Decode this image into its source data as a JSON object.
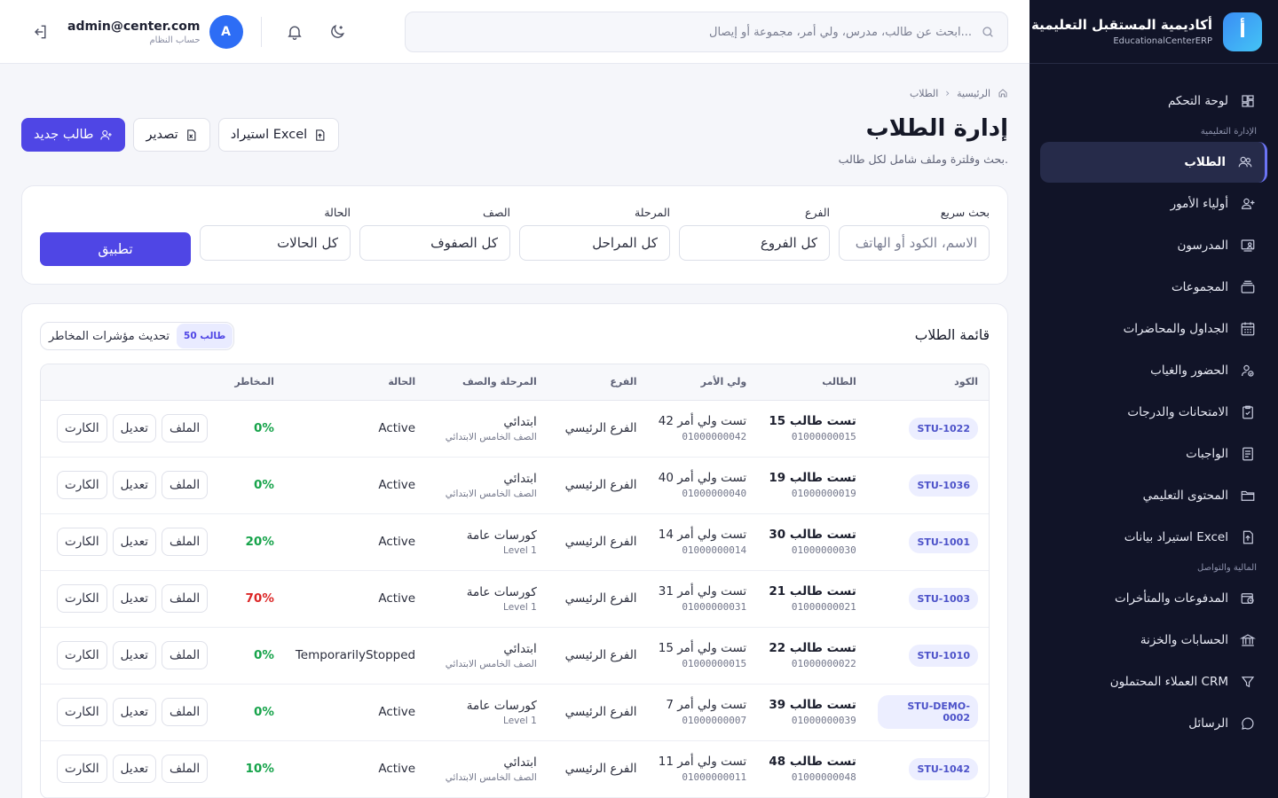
{
  "brand": {
    "title": "أكاديمية المستقبل التعليمية",
    "subtitle": "EducationalCenterERP",
    "logo_letter": "أ"
  },
  "sidebar": {
    "items_top": [
      {
        "label": "لوحة التحكم",
        "icon": "dashboard-icon"
      }
    ],
    "section_1": "الإدارة التعليمية",
    "items_1": [
      {
        "label": "الطلاب",
        "icon": "students-icon",
        "active": true
      },
      {
        "label": "أولياء الأمور",
        "icon": "parents-icon"
      },
      {
        "label": "المدرسون",
        "icon": "teachers-icon"
      },
      {
        "label": "المجموعات",
        "icon": "groups-icon"
      },
      {
        "label": "الجداول والمحاضرات",
        "icon": "calendar-icon"
      },
      {
        "label": "الحضور والغياب",
        "icon": "attendance-icon"
      },
      {
        "label": "الامتحانات والدرجات",
        "icon": "exams-icon"
      },
      {
        "label": "الواجبات",
        "icon": "assignments-icon"
      },
      {
        "label": "المحتوى التعليمي",
        "icon": "folder-icon"
      },
      {
        "label": "استيراد بيانات Excel",
        "icon": "import-icon"
      }
    ],
    "section_2": "المالية والتواصل",
    "items_2": [
      {
        "label": "المدفوعات والمتأخرات",
        "icon": "payments-icon"
      },
      {
        "label": "الحسابات والخزنة",
        "icon": "bank-icon"
      },
      {
        "label": "العملاء المحتملون CRM",
        "icon": "funnel-icon"
      },
      {
        "label": "الرسائل",
        "icon": "messages-icon"
      }
    ]
  },
  "topbar": {
    "search_placeholder": "ابحث عن طالب، مدرس، ولي أمر، مجموعة أو إيصال...",
    "user_email": "admin@center.com",
    "user_role": "حساب النظام",
    "avatar_letter": "A"
  },
  "breadcrumb": {
    "home": "الرئيسية",
    "current": "الطلاب"
  },
  "page": {
    "title": "إدارة الطلاب",
    "subtitle": "بحث وفلترة وملف شامل لكل طالب.",
    "import_label": "استيراد Excel",
    "export_label": "تصدير",
    "new_label": "طالب جديد"
  },
  "filters": {
    "search": {
      "label": "بحث سريع",
      "placeholder": "الاسم، الكود أو الهاتف"
    },
    "branch": {
      "label": "الفرع",
      "value": "كل الفروع"
    },
    "stage": {
      "label": "المرحلة",
      "value": "كل المراحل"
    },
    "grade": {
      "label": "الصف",
      "value": "كل الصفوف"
    },
    "status": {
      "label": "الحالة",
      "value": "كل الحالات"
    },
    "apply_label": "تطبيق"
  },
  "list": {
    "title": "قائمة الطلاب",
    "count_badge": "50 طالب",
    "refresh_risk_label": "تحديث مؤشرات المخاطر",
    "columns": [
      "الكود",
      "الطالب",
      "ولي الأمر",
      "الفرع",
      "المرحلة والصف",
      "الحالة",
      "المخاطر",
      ""
    ],
    "action_labels": {
      "profile": "الملف",
      "edit": "تعديل",
      "card": "الكارت"
    },
    "rows": [
      {
        "code": "STU-1022",
        "name": "تست طالب 15",
        "phone": "01000000015",
        "parent": "تست ولي أمر 42",
        "parent_phone": "01000000042",
        "branch": "الفرع الرئيسي",
        "stage": "ابتدائي",
        "grade": "الصف الخامس الابتدائي",
        "status": "Active",
        "risk": "0%",
        "risk_color": "#16a34a"
      },
      {
        "code": "STU-1036",
        "name": "تست طالب 19",
        "phone": "01000000019",
        "parent": "تست ولي أمر 40",
        "parent_phone": "01000000040",
        "branch": "الفرع الرئيسي",
        "stage": "ابتدائي",
        "grade": "الصف الخامس الابتدائي",
        "status": "Active",
        "risk": "0%",
        "risk_color": "#16a34a"
      },
      {
        "code": "STU-1001",
        "name": "تست طالب 30",
        "phone": "01000000030",
        "parent": "تست ولي أمر 14",
        "parent_phone": "01000000014",
        "branch": "الفرع الرئيسي",
        "stage": "كورسات عامة",
        "grade": "Level 1",
        "status": "Active",
        "risk": "20%",
        "risk_color": "#16a34a"
      },
      {
        "code": "STU-1003",
        "name": "تست طالب 21",
        "phone": "01000000021",
        "parent": "تست ولي أمر 31",
        "parent_phone": "01000000031",
        "branch": "الفرع الرئيسي",
        "stage": "كورسات عامة",
        "grade": "Level 1",
        "status": "Active",
        "risk": "70%",
        "risk_color": "#dc2626"
      },
      {
        "code": "STU-1010",
        "name": "تست طالب 22",
        "phone": "01000000022",
        "parent": "تست ولي أمر 15",
        "parent_phone": "01000000015",
        "branch": "الفرع الرئيسي",
        "stage": "ابتدائي",
        "grade": "الصف الخامس الابتدائي",
        "status": "TemporarilyStopped",
        "risk": "0%",
        "risk_color": "#16a34a"
      },
      {
        "code": "STU-DEMO-0002",
        "name": "تست طالب 39",
        "phone": "01000000039",
        "parent": "تست ولي أمر 7",
        "parent_phone": "01000000007",
        "branch": "الفرع الرئيسي",
        "stage": "كورسات عامة",
        "grade": "Level 1",
        "status": "Active",
        "risk": "0%",
        "risk_color": "#16a34a"
      },
      {
        "code": "STU-1042",
        "name": "تست طالب 48",
        "phone": "01000000048",
        "parent": "تست ولي أمر 11",
        "parent_phone": "01000000011",
        "branch": "الفرع الرئيسي",
        "stage": "ابتدائي",
        "grade": "الصف الخامس الابتدائي",
        "status": "Active",
        "risk": "10%",
        "risk_color": "#16a34a"
      }
    ]
  }
}
